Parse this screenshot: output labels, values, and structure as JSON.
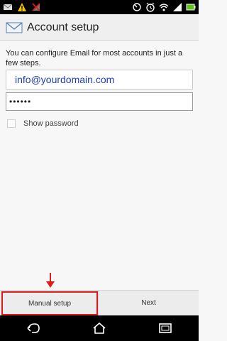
{
  "header": {
    "title": "Account setup"
  },
  "intro_text": "You can configure Email for most accounts in just a few steps.",
  "email": {
    "value": "info@yourdomain.com"
  },
  "password": {
    "value": "••••••"
  },
  "show_password_label": "Show password",
  "actions": {
    "manual_label": "Manual setup",
    "next_label": "Next"
  },
  "colors": {
    "highlight": "#e01b1b",
    "email_text": "#1d3fb5",
    "status_bar": "#000000"
  },
  "icons": {
    "status_left": [
      "mail-icon",
      "warning-icon",
      "signal-off-icon"
    ],
    "status_right": [
      "sync-icon",
      "alarm-icon",
      "wifi-icon",
      "signal-icon",
      "battery-icon"
    ],
    "nav": [
      "back-icon",
      "home-icon",
      "recent-apps-icon"
    ]
  }
}
